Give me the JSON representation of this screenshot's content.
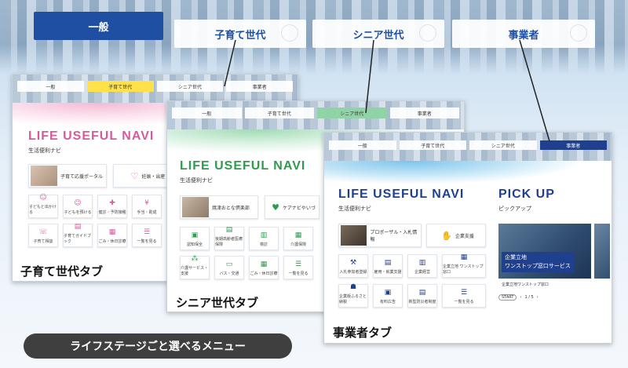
{
  "top_tabs": [
    "一般",
    "子育て世代",
    "シニア世代",
    "事業者"
  ],
  "colors": {
    "navy": "#1f4fa3",
    "pink": "#d65a9b",
    "green": "#2e9b4d",
    "yellow": "#ffe14a",
    "mint": "#8fd3a6",
    "dark": "#3f3f3f"
  },
  "screens": {
    "kosodate": {
      "tabs": [
        "一般",
        "子育て世代",
        "シニア世代",
        "事業者"
      ],
      "title": "LIFE USEFUL NAVI",
      "subtitle": "生活便利ナビ",
      "features": [
        "子育て応援ポータル",
        "妊娠・出産"
      ],
      "tiles": [
        "子どもと出かける",
        "子どもを預ける",
        "健診・予防接種",
        "手当・助成",
        "子育て相談",
        "子育てガイドブック",
        "ごみ・休日診療",
        "一覧を見る"
      ],
      "caption": "子育て世代タブ"
    },
    "senior": {
      "tabs": [
        "一般",
        "子育て世代",
        "シニア世代",
        "事業者"
      ],
      "title": "LIFE USEFUL NAVI",
      "subtitle": "生活便利ナビ",
      "features": [
        "焼津おとな倶楽部",
        "ケアナビやいづ"
      ],
      "tiles": [
        "認知保全",
        "後期高齢者医療保険",
        "検診",
        "介護保険",
        "介護サービス・支援",
        "バス・交通",
        "ごみ・休日診療",
        "一覧を見る"
      ],
      "caption": "シニア世代タブ"
    },
    "jigyosha": {
      "tabs": [
        "一般",
        "子育て世代",
        "シニア世代",
        "事業者"
      ],
      "title": "LIFE USEFUL NAVI",
      "subtitle": "生活便利ナビ",
      "features": [
        "プロポーザル・入札情報",
        "企業支援"
      ],
      "tiles": [
        "入札参加者登録",
        "雇用・就業支援",
        "企業経営",
        "企業立地 ワンストップ窓口",
        "企業版ふるさと納税",
        "有料広告",
        "新型防災者制度",
        "一覧を見る"
      ],
      "pickup_title": "PICK UP",
      "pickup_sub": "ピックアップ",
      "pickup_card": [
        "企業立地",
        "ワンストップ窓口サービス"
      ],
      "pickup_caption": "企業立地ワンストップ窓口",
      "slider": [
        "START",
        "1 / 5"
      ],
      "caption": "事業者タブ"
    }
  },
  "pill_text": "ライフステージごと選べるメニュー"
}
